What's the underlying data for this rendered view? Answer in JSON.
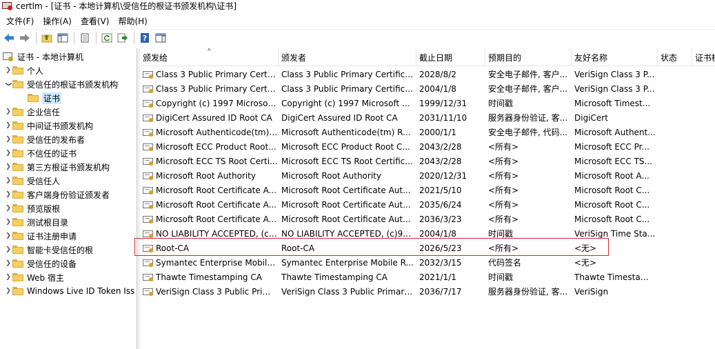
{
  "window": {
    "title": "certlm - [证书 - 本地计算机\\受信任的根证书颁发机构\\证书]"
  },
  "menu": [
    "文件(F)",
    "操作(A)",
    "查看(V)",
    "帮助(H)"
  ],
  "tree": {
    "root": "证书 - 本地计算机",
    "items": [
      {
        "label": "个人",
        "expanded": false
      },
      {
        "label": "受信任的根证书颁发机构",
        "expanded": true
      },
      {
        "label": "证书",
        "selected": true
      },
      {
        "label": "企业信任",
        "expanded": false
      },
      {
        "label": "中间证书颁发机构",
        "expanded": false
      },
      {
        "label": "受信任的发布者",
        "expanded": false
      },
      {
        "label": "不信任的证书",
        "expanded": false
      },
      {
        "label": "第三方根证书颁发机构",
        "expanded": false
      },
      {
        "label": "受信任人",
        "expanded": false
      },
      {
        "label": "客户端身份验证颁发者",
        "expanded": false
      },
      {
        "label": "预览版根",
        "expanded": false
      },
      {
        "label": "测试根目录",
        "expanded": false
      },
      {
        "label": "证书注册申请",
        "expanded": false
      },
      {
        "label": "智能卡受信任的根",
        "expanded": false
      },
      {
        "label": "受信任的设备",
        "expanded": false
      },
      {
        "label": "Web 宿主",
        "expanded": false
      },
      {
        "label": "Windows Live ID Token Iss",
        "expanded": false
      }
    ]
  },
  "list": {
    "columns": [
      "颁发给",
      "颁发者",
      "截止日期",
      "预期目的",
      "友好名称",
      "状态",
      "证书模"
    ],
    "rows": [
      [
        "Class 3 Public Primary Certifi...",
        "Class 3 Public Primary Certifica...",
        "2028/8/2",
        "安全电子邮件, 客户...",
        "VeriSign Class 3 P..."
      ],
      [
        "Class 3 Public Primary Certifi...",
        "Class 3 Public Primary Certifica...",
        "2004/1/8",
        "安全电子邮件, 客户...",
        "VeriSign Class 3 P..."
      ],
      [
        "Copyright (c) 1997 Microsoft...",
        "Copyright (c) 1997 Microsoft C...",
        "1999/12/31",
        "时间戳",
        "Microsoft Timest..."
      ],
      [
        "DigiCert Assured ID Root CA",
        "DigiCert Assured ID Root CA",
        "2031/11/10",
        "服务器身份验证, 客...",
        "DigiCert"
      ],
      [
        "Microsoft Authenticode(tm) ...",
        "Microsoft Authenticode(tm) Ro...",
        "2000/1/1",
        "安全电子邮件, 代码...",
        "Microsoft Authent..."
      ],
      [
        "Microsoft ECC Product Root...",
        "Microsoft ECC Product Root C...",
        "2043/2/28",
        "<所有>",
        "Microsoft ECC Pr..."
      ],
      [
        "Microsoft ECC TS Root Certi...",
        "Microsoft ECC TS Root Certific...",
        "2043/2/28",
        "<所有>",
        "Microsoft ECC TS..."
      ],
      [
        "Microsoft Root Authority",
        "Microsoft Root Authority",
        "2020/12/31",
        "<所有>",
        "Microsoft Root A..."
      ],
      [
        "Microsoft Root Certificate A...",
        "Microsoft Root Certificate Aut...",
        "2021/5/10",
        "<所有>",
        "Microsoft Root C..."
      ],
      [
        "Microsoft Root Certificate A...",
        "Microsoft Root Certificate Aut...",
        "2035/6/24",
        "<所有>",
        "Microsoft Root C..."
      ],
      [
        "Microsoft Root Certificate A...",
        "Microsoft Root Certificate Aut...",
        "2036/3/23",
        "<所有>",
        "Microsoft Root C..."
      ],
      [
        "NO LIABILITY ACCEPTED, (c)...",
        "NO LIABILITY ACCEPTED, (c)97...",
        "2004/1/8",
        "时间戳",
        "VeriSign Time Sta..."
      ],
      [
        "Root-CA",
        "Root-CA",
        "2026/5/23",
        "<所有>",
        "<无>"
      ],
      [
        "Symantec Enterprise Mobile ...",
        "Symantec Enterprise Mobile R...",
        "2032/3/15",
        "代码签名",
        "<无>"
      ],
      [
        "Thawte Timestamping CA",
        "Thawte Timestamping CA",
        "2021/1/1",
        "时间戳",
        "Thawte Timestam..."
      ],
      [
        "VeriSign Class 3 Public Prim...",
        "VeriSign Class 3 Public Primary...",
        "2036/7/17",
        "服务器身份验证, 客...",
        "VeriSign"
      ]
    ]
  },
  "colors": {
    "highlight": "#d9232e",
    "selection": "#cce8ff"
  }
}
